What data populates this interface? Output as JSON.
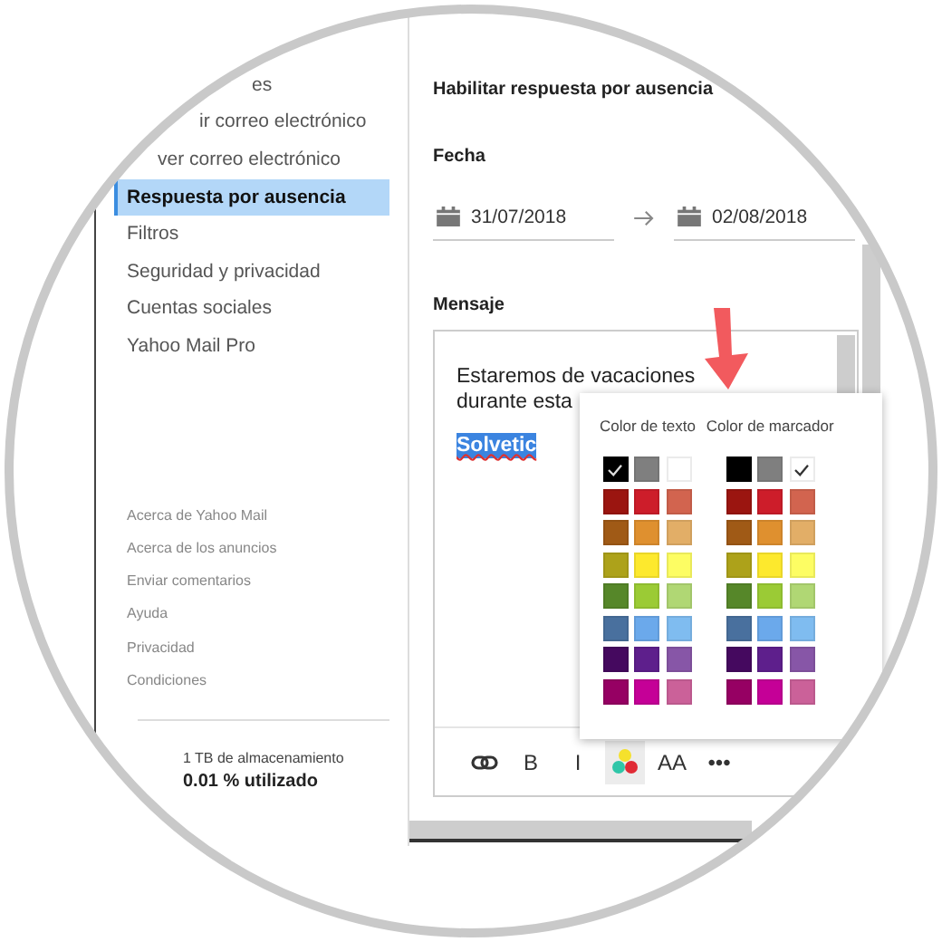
{
  "sidebar": {
    "items": [
      {
        "label": "es",
        "selected": false
      },
      {
        "label": "ir correo electrónico",
        "selected": false
      },
      {
        "label": "ver correo electrónico",
        "selected": false
      },
      {
        "label": "Respuesta por ausencia",
        "selected": true
      },
      {
        "label": "Filtros",
        "selected": false
      },
      {
        "label": "Seguridad y privacidad",
        "selected": false
      },
      {
        "label": "Cuentas sociales",
        "selected": false
      },
      {
        "label": "Yahoo Mail Pro",
        "selected": false
      }
    ],
    "footer_links": [
      "Acerca de Yahoo Mail",
      "Acerca de los anuncios",
      "Enviar comentarios",
      "Ayuda",
      "Privacidad",
      "Condiciones"
    ],
    "storage": {
      "label": "1 TB de almacenamiento",
      "usage": "0.01 % utilizado"
    }
  },
  "main": {
    "heading": "Habilitar respuesta por ausencia",
    "date_label": "Fecha",
    "date_from": {
      "value": "31/07/2018"
    },
    "date_to": {
      "value": "02/08/2018"
    },
    "message_label": "Mensaje",
    "message": [
      {
        "text": "Estaremos de vacaciones",
        "selected": false
      },
      {
        "text": "durante esta",
        "selected": false
      },
      {
        "text": "Solvetic",
        "selected": true
      }
    ],
    "toolbar": [
      {
        "kind": "link",
        "active": false
      },
      {
        "kind": "bold",
        "label": "B",
        "active": false
      },
      {
        "kind": "italic",
        "label": "I",
        "active": false
      },
      {
        "kind": "color",
        "active": true
      },
      {
        "kind": "size",
        "label": "AA",
        "active": false
      },
      {
        "kind": "more",
        "label": "•••",
        "active": false
      }
    ]
  },
  "color_popup": {
    "palettes": [
      {
        "title": "Color de texto",
        "swatches": [
          {
            "color": "#000000",
            "selected": true
          },
          {
            "color": "#7f7f7f",
            "selected": false
          },
          {
            "color": "#ffffff",
            "selected": false
          },
          {
            "color": "#9b1510",
            "selected": false
          },
          {
            "color": "#cd1d2a",
            "selected": false
          },
          {
            "color": "#d2644f",
            "selected": false
          },
          {
            "color": "#a05a16",
            "selected": false
          },
          {
            "color": "#df902f",
            "selected": false
          },
          {
            "color": "#e2ae67",
            "selected": false
          },
          {
            "color": "#ada21a",
            "selected": false
          },
          {
            "color": "#fde92d",
            "selected": false
          },
          {
            "color": "#fdfd63",
            "selected": false
          },
          {
            "color": "#568729",
            "selected": false
          },
          {
            "color": "#9bcb35",
            "selected": false
          },
          {
            "color": "#b0d774",
            "selected": false
          },
          {
            "color": "#49709e",
            "selected": false
          },
          {
            "color": "#6ba9eb",
            "selected": false
          },
          {
            "color": "#7fbcf0",
            "selected": false
          },
          {
            "color": "#45095f",
            "selected": false
          },
          {
            "color": "#5e1f8c",
            "selected": false
          },
          {
            "color": "#8756a7",
            "selected": false
          },
          {
            "color": "#960063",
            "selected": false
          },
          {
            "color": "#c50097",
            "selected": false
          },
          {
            "color": "#cb6199",
            "selected": false
          }
        ]
      },
      {
        "title": "Color de marcador",
        "swatches": [
          {
            "color": "#000000",
            "selected": false
          },
          {
            "color": "#7f7f7f",
            "selected": false
          },
          {
            "color": "#ffffff",
            "selected": true
          },
          {
            "color": "#9b1510",
            "selected": false
          },
          {
            "color": "#cd1d2a",
            "selected": false
          },
          {
            "color": "#d2644f",
            "selected": false
          },
          {
            "color": "#a05a16",
            "selected": false
          },
          {
            "color": "#df902f",
            "selected": false
          },
          {
            "color": "#e2ae67",
            "selected": false
          },
          {
            "color": "#ada21a",
            "selected": false
          },
          {
            "color": "#fde92d",
            "selected": false
          },
          {
            "color": "#fdfd63",
            "selected": false
          },
          {
            "color": "#568729",
            "selected": false
          },
          {
            "color": "#9bcb35",
            "selected": false
          },
          {
            "color": "#b0d774",
            "selected": false
          },
          {
            "color": "#49709e",
            "selected": false
          },
          {
            "color": "#6ba9eb",
            "selected": false
          },
          {
            "color": "#7fbcf0",
            "selected": false
          },
          {
            "color": "#45095f",
            "selected": false
          },
          {
            "color": "#5e1f8c",
            "selected": false
          },
          {
            "color": "#8756a7",
            "selected": false
          },
          {
            "color": "#960063",
            "selected": false
          },
          {
            "color": "#c50097",
            "selected": false
          },
          {
            "color": "#cb6199",
            "selected": false
          }
        ]
      }
    ]
  }
}
